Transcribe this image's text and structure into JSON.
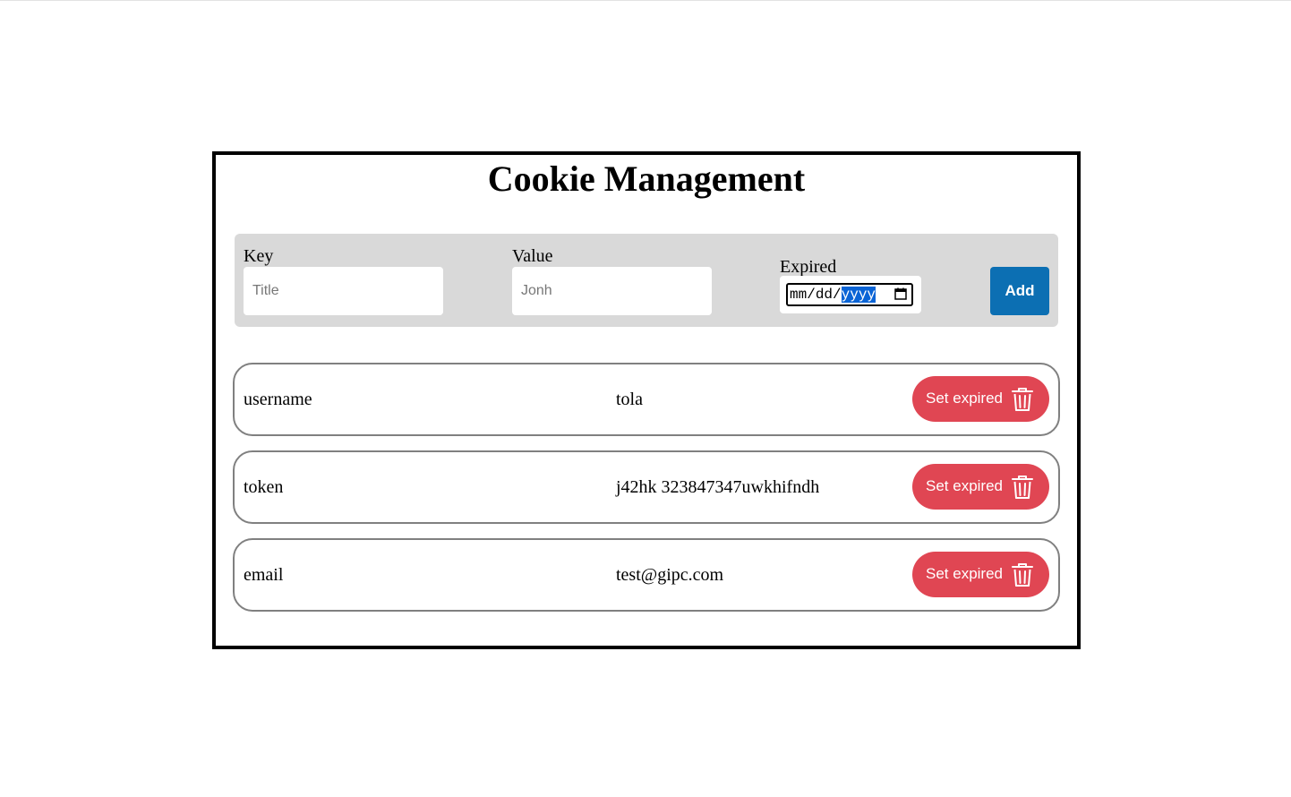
{
  "page": {
    "title": "Cookie Management"
  },
  "form": {
    "key_label": "Key",
    "key_placeholder": "Title",
    "value_label": "Value",
    "value_placeholder": "Jonh",
    "expired_label": "Expired",
    "date_month": "mm",
    "date_day": "dd",
    "date_year": "yyyy",
    "date_separator": "/",
    "add_label": "Add"
  },
  "cookies": [
    {
      "key": "username",
      "value": "tola",
      "action_label": "Set expired"
    },
    {
      "key": "token",
      "value": "j42hk 323847347uwkhifndh",
      "action_label": "Set expired"
    },
    {
      "key": "email",
      "value": "test@gipc.com",
      "action_label": "Set expired"
    }
  ],
  "icons": {
    "calendar": "calendar-icon",
    "trash": "trash-icon"
  },
  "colors": {
    "add_button": "#0c6fb3",
    "expire_button": "#e04653",
    "form_background": "#d9d9d9",
    "date_selection": "#0a64d6"
  }
}
